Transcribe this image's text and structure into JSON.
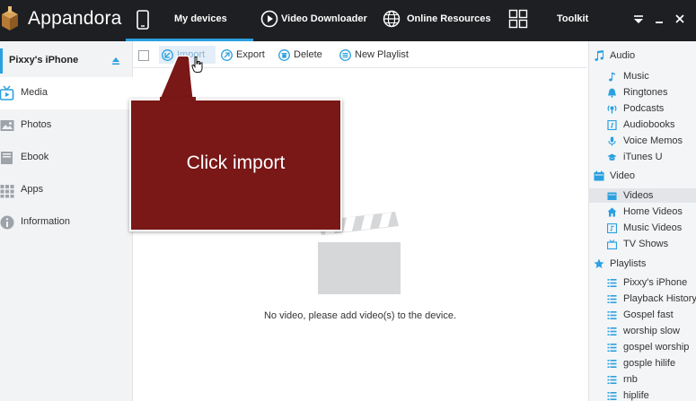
{
  "app": {
    "title": "Appandora"
  },
  "nav": {
    "my_devices": "My devices",
    "video_downloader": "Video Downloader",
    "online_resources": "Online Resources",
    "toolkit": "Toolkit"
  },
  "device": {
    "name": "Pixxy's iPhone"
  },
  "sidebar": {
    "items": [
      {
        "label": "Media",
        "icon": "media-icon"
      },
      {
        "label": "Photos",
        "icon": "photos-icon"
      },
      {
        "label": "Ebook",
        "icon": "ebook-icon"
      },
      {
        "label": "Apps",
        "icon": "apps-icon"
      },
      {
        "label": "Information",
        "icon": "information-icon"
      }
    ]
  },
  "toolbar": {
    "import": "Import",
    "export": "Export",
    "delete": "Delete",
    "new_playlist": "New Playlist"
  },
  "main": {
    "empty_text": "No video, please add video(s) to the device.",
    "callout": "Click import"
  },
  "library": {
    "audio": {
      "label": "Audio",
      "items": [
        "Music",
        "Ringtones",
        "Podcasts",
        "Audiobooks",
        "Voice Memos",
        "iTunes U"
      ]
    },
    "video": {
      "label": "Video",
      "items": [
        "Videos",
        "Home Videos",
        "Music Videos",
        "TV Shows"
      ]
    },
    "playlists": {
      "label": "Playlists",
      "items": [
        "Pixxy's iPhone",
        "Playback History",
        "Gospel fast",
        "worship slow",
        "gospel worship",
        "gosple hilife",
        "rnb",
        "hiplife"
      ]
    }
  },
  "colors": {
    "accent": "#2aa0e0",
    "topbar": "#1e1f22",
    "callout": "#7a1717"
  }
}
